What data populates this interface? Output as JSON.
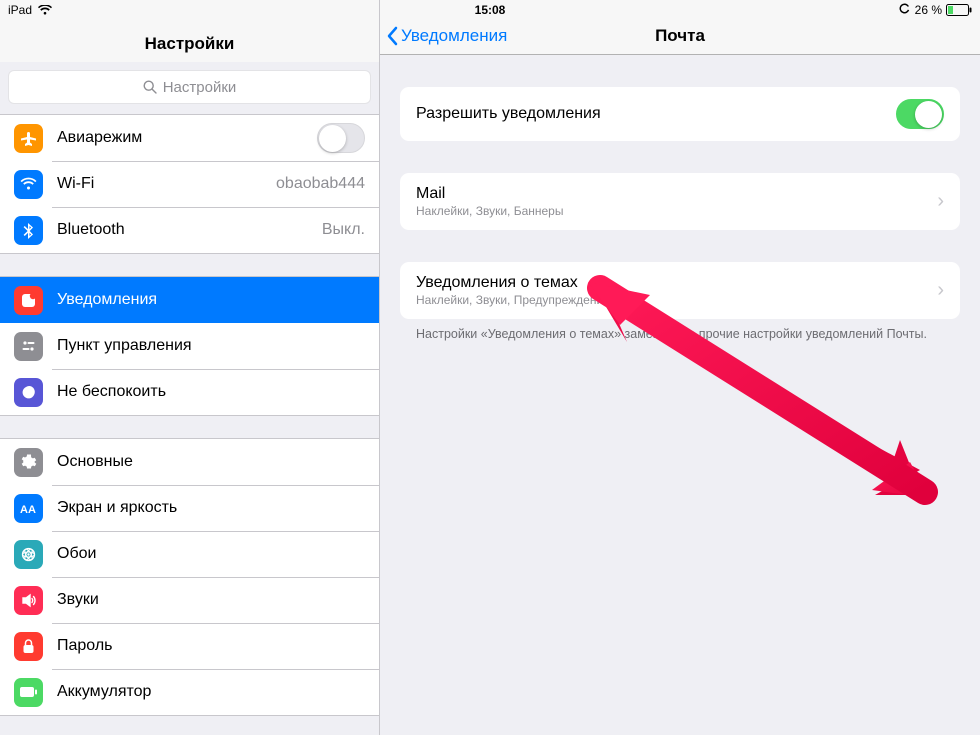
{
  "status": {
    "device": "iPad",
    "time": "15:08",
    "battery_pct": "26 %"
  },
  "sidebar": {
    "title": "Настройки",
    "search_placeholder": "Настройки",
    "groups": [
      {
        "rows": [
          {
            "label": "Авиарежим",
            "kind": "toggle",
            "on": false
          },
          {
            "label": "Wi-Fi",
            "value": "obaobab444",
            "kind": "link"
          },
          {
            "label": "Bluetooth",
            "value": "Выкл.",
            "kind": "link"
          }
        ]
      },
      {
        "rows": [
          {
            "label": "Уведомления",
            "kind": "link",
            "selected": true
          },
          {
            "label": "Пункт управления",
            "kind": "link"
          },
          {
            "label": "Не беспокоить",
            "kind": "link"
          }
        ]
      },
      {
        "rows": [
          {
            "label": "Основные",
            "kind": "link"
          },
          {
            "label": "Экран и яркость",
            "kind": "link"
          },
          {
            "label": "Обои",
            "kind": "link"
          },
          {
            "label": "Звуки",
            "kind": "link"
          },
          {
            "label": "Пароль",
            "kind": "link"
          },
          {
            "label": "Аккумулятор",
            "kind": "link"
          }
        ]
      }
    ]
  },
  "main": {
    "back_label": "Уведомления",
    "title": "Почта",
    "allow_label": "Разрешить уведомления",
    "allow_on": true,
    "accounts": [
      {
        "title": "Mail",
        "sub": "Наклейки, Звуки, Баннеры"
      }
    ],
    "thread": {
      "title": "Уведомления о темах",
      "sub": "Наклейки, Звуки, Предупреждения"
    },
    "footer": "Настройки «Уведомления о темах» заменят все прочие настройки уведомлений Почты."
  }
}
